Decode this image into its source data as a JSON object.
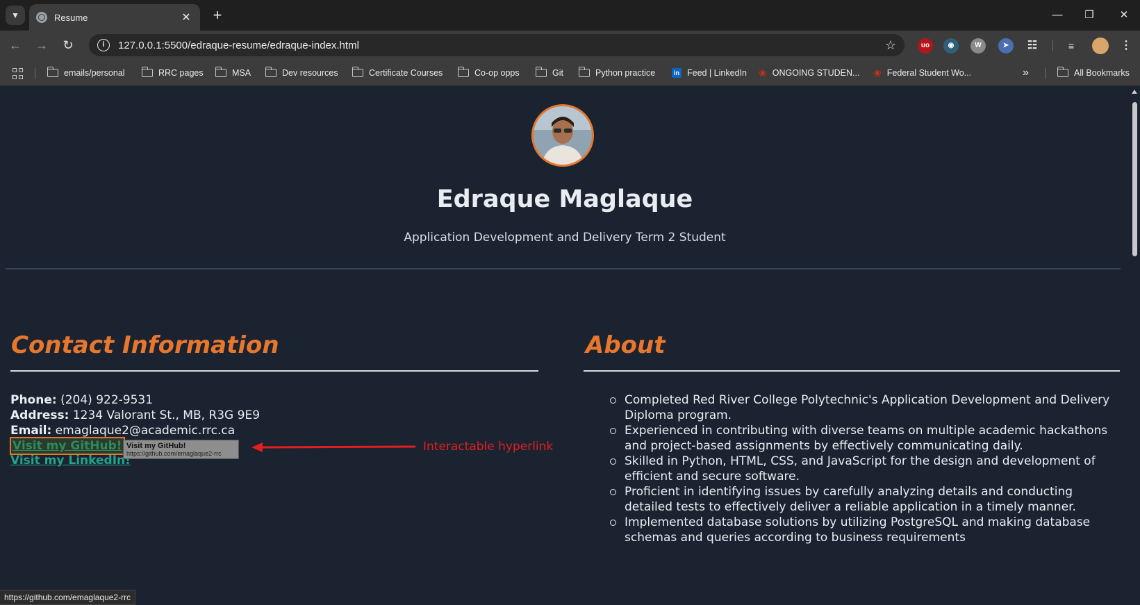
{
  "browser": {
    "tab_title": "Resume",
    "url": "127.0.0.1:5500/edraque-resume/edraque-index.html",
    "bookmarks": [
      {
        "label": "emails/personal",
        "icon": "folder-icon"
      },
      {
        "label": "RRC pages",
        "icon": "folder-icon"
      },
      {
        "label": "MSA",
        "icon": "folder-icon"
      },
      {
        "label": "Dev resources",
        "icon": "folder-icon"
      },
      {
        "label": "Certificate Courses",
        "icon": "folder-icon"
      },
      {
        "label": "Co-op opps",
        "icon": "folder-icon"
      },
      {
        "label": "Git",
        "icon": "folder-icon"
      },
      {
        "label": "Python practice",
        "icon": "folder-icon"
      },
      {
        "label": "Feed | LinkedIn",
        "icon": "linkedin-icon"
      },
      {
        "label": "ONGOING STUDEN...",
        "icon": "maple-leaf-icon"
      },
      {
        "label": "Federal Student Wo...",
        "icon": "maple-leaf-icon"
      }
    ],
    "all_bookmarks": "All Bookmarks",
    "status_url": "https://github.com/emaglaque2-rrc"
  },
  "header": {
    "name": "Edraque Maglaque",
    "subtitle": "Application Development and Delivery Term 2 Student"
  },
  "contact": {
    "title": "Contact Information",
    "phone_label": "Phone:",
    "phone": "(204) 922-9531",
    "address_label": "Address:",
    "address": "1234 Valorant St., MB, R3G 9E9",
    "email_label": "Email:",
    "email": "emaglaque2@academic.rrc.ca",
    "github_link": "Visit my GitHub!",
    "linkedin_link": "Visit my LinkedIn!",
    "tooltip_title": "Visit my GitHub!",
    "tooltip_url": "https://github.com/emaglaque2-rrc"
  },
  "about": {
    "title": "About",
    "items": [
      "Completed Red River College Polytechnic's Application Development and Delivery Diploma program.",
      "Experienced in contributing with diverse teams on multiple academic hackathons and project-based assignments by effectively communicating daily.",
      "Skilled in Python, HTML, CSS, and JavaScript for the design and development of efficient and secure software.",
      "Proficient in identifying issues by carefully analyzing details and conducting detailed tests to effectively deliver a reliable application in a timely manner.",
      "Implemented database solutions by utilizing PostgreSQL and making database schemas and queries according to business requirements"
    ]
  },
  "annotation": {
    "label": "Interactable hyperlink",
    "color": "#e21f1f"
  },
  "colors": {
    "accent": "#e8772e",
    "link": "#20a58a",
    "page_bg": "#1b2330"
  }
}
